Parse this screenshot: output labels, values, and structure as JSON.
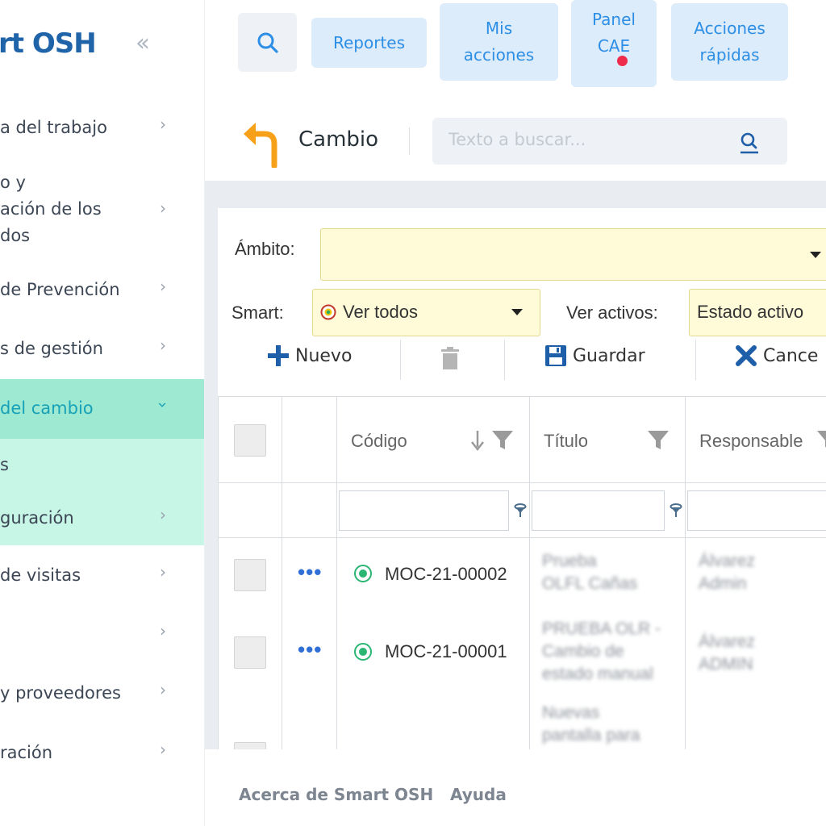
{
  "sidebar": {
    "logo": "rt OSH",
    "items": [
      {
        "label": "a del trabajo"
      },
      {
        "label_lines": [
          "o y",
          "ación de los",
          "dos"
        ]
      },
      {
        "label": "de Prevención"
      },
      {
        "label": "s de gestión"
      },
      {
        "label": "del cambio"
      },
      {
        "label": "s"
      },
      {
        "label": "guración"
      },
      {
        "label": "de visitas"
      },
      {
        "label": ""
      },
      {
        "label": "y proveedores"
      },
      {
        "label": "ración"
      }
    ]
  },
  "topbar": {
    "reportes": "Reportes",
    "mis_acciones": [
      "Mis",
      "acciones"
    ],
    "panel_cae": [
      "Panel",
      "CAE"
    ],
    "acciones_rapidas": [
      "Acciones",
      "rápidas"
    ]
  },
  "header": {
    "title": "Cambio",
    "search_placeholder": "Texto a buscar..."
  },
  "filters": {
    "ambito_label": "Ámbito:",
    "smart_label": "Smart:",
    "smart_value": "Ver todos",
    "ver_activos_label": "Ver activos:",
    "ver_activos_value": "Estado activo"
  },
  "toolbar": {
    "nuevo": "Nuevo",
    "guardar": "Guardar",
    "cancelar": "Cance"
  },
  "table": {
    "columns": [
      "Código",
      "Título",
      "Responsable"
    ],
    "rows": [
      {
        "code": "MOC-21-00002",
        "title_lines": [
          "Prueba",
          "OLFL Cañas"
        ],
        "resp_lines": [
          "Álvarez",
          "Admin"
        ]
      },
      {
        "code": "MOC-21-00001",
        "title_lines": [
          "PRUEBA OLR -",
          "Cambio de",
          "estado manual"
        ],
        "resp_lines": [
          "Álvarez",
          "ADMIN"
        ]
      },
      {
        "code": "",
        "title_lines": [
          "Nuevas",
          "pantalla para"
        ],
        "resp_lines": [
          ""
        ]
      }
    ]
  },
  "footer": {
    "about": "Acerca de Smart OSH",
    "help": "Ayuda"
  },
  "colors": {
    "brand": "#1f63a8",
    "accent": "#2d8ee6",
    "active_nav": "#9ee9d1",
    "sub_nav": "#c7f5e6",
    "status_active": "#2bb673",
    "notification": "#ee2b4a",
    "back_arrow": "#f7a11a"
  }
}
